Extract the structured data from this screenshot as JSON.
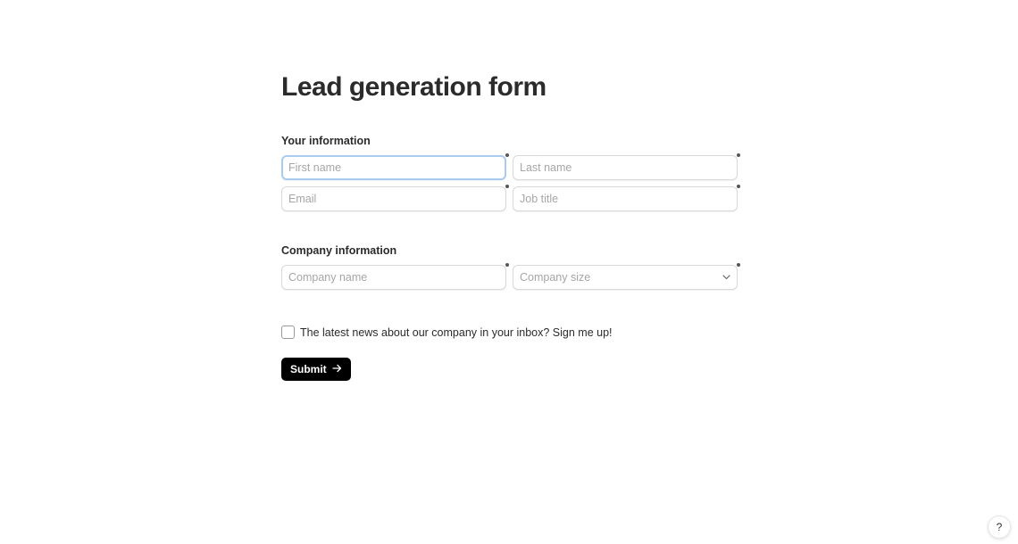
{
  "form": {
    "title": "Lead generation form",
    "your_information": {
      "label": "Your information",
      "first_name": {
        "placeholder": "First name",
        "value": ""
      },
      "last_name": {
        "placeholder": "Last name",
        "value": ""
      },
      "email": {
        "placeholder": "Email",
        "value": ""
      },
      "job_title": {
        "placeholder": "Job title",
        "value": ""
      }
    },
    "company_information": {
      "label": "Company information",
      "company_name": {
        "placeholder": "Company name",
        "value": ""
      },
      "company_size": {
        "placeholder": "Company size"
      }
    },
    "newsletter": {
      "label": "The latest news about our company in your inbox? Sign me up!",
      "checked": false
    },
    "submit_label": "Submit"
  },
  "help_label": "?",
  "icons": {
    "required": "required-dot-icon",
    "select": "chevron-down-icon",
    "submit": "arrow-right-icon"
  },
  "colors": {
    "button_bg": "#000000",
    "focus_border": "#a9cbee",
    "placeholder": "#a6a6a6"
  }
}
